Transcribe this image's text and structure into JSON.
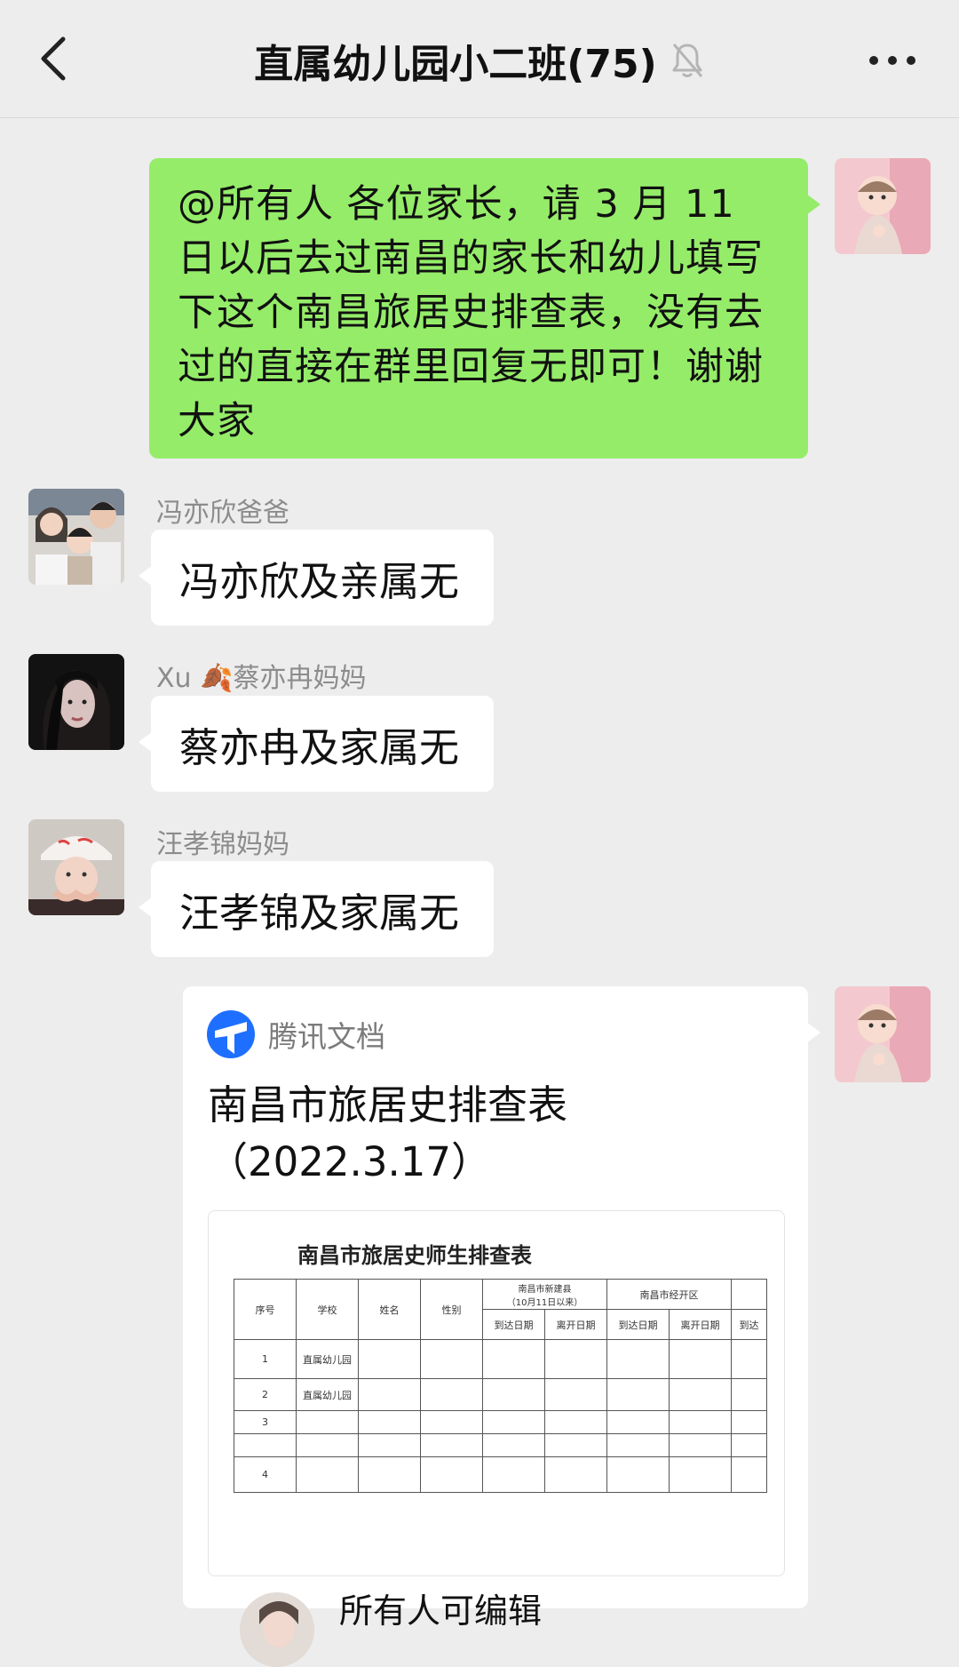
{
  "header": {
    "title": "直属幼儿园小二班(75)",
    "muted_icon": "bell-muted-icon",
    "back_icon": "chevron-left-icon",
    "more_icon": "more-dots-icon"
  },
  "messages": {
    "self_text": "@所有人  各位家长，请 3 月 11 日以后去过南昌的家长和幼儿填写下这个南昌旅居史排查表，没有去过的直接在群里回复无即可！谢谢大家",
    "replies": [
      {
        "sender": "冯亦欣爸爸",
        "text": "冯亦欣及亲属无"
      },
      {
        "sender": "Xu 🍂蔡亦冉妈妈",
        "text": "蔡亦冉及家属无"
      },
      {
        "sender": "汪孝锦妈妈",
        "text": "汪孝锦及家属无"
      }
    ]
  },
  "doc_card": {
    "app_name": "腾讯文档",
    "title": "南昌市旅居史排查表\n（2022.3.17）",
    "permission": "所有人可编辑",
    "preview": {
      "sheet_title": "南昌市旅居史师生排查表",
      "headers": [
        "序号",
        "学校",
        "姓名",
        "性别"
      ],
      "region1": "南昌市新建县\n（10月11日以来）",
      "region2": "南昌市经开区",
      "sub_headers": [
        "到达日期",
        "离开日期",
        "到达日期",
        "离开日期",
        "到达"
      ],
      "rows": [
        {
          "no": "1",
          "school": "直属幼儿园"
        },
        {
          "no": "2",
          "school": "直属幼儿园"
        },
        {
          "no": "3",
          "school": ""
        },
        {
          "no": "",
          "school": ""
        },
        {
          "no": "4",
          "school": ""
        }
      ]
    }
  },
  "colors": {
    "background": "#ededed",
    "self_bubble": "#95ec69",
    "other_bubble": "#ffffff",
    "doc_logo": "#1e6fff"
  }
}
